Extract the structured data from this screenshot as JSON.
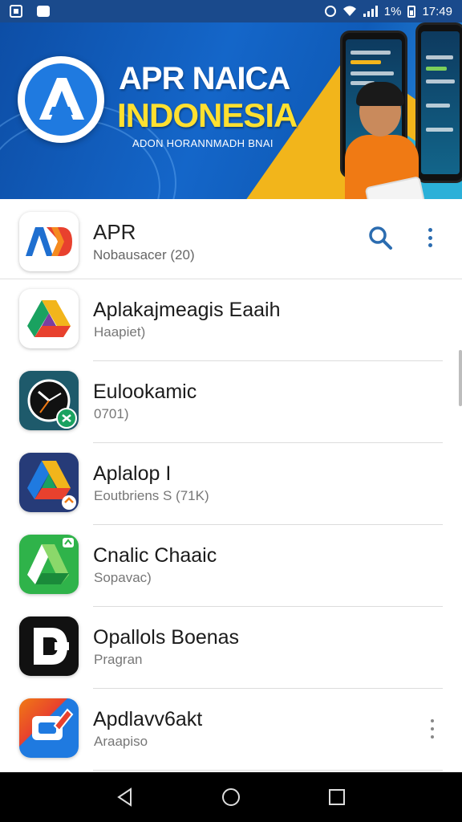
{
  "status_bar": {
    "battery_text": "1%",
    "time": "17:49"
  },
  "banner": {
    "title_line1": "APR NAICA",
    "title_line2": "INDONESIA",
    "subtitle": "ADON HORANNMADH BNAI"
  },
  "header": {
    "app_name": "APR",
    "subtitle": "Nobausacer (20)"
  },
  "apps": [
    {
      "name": "Aplakajmeagis Eaaih",
      "detail": "Haapiet)",
      "icon": "drive-triangle-icon"
    },
    {
      "name": "Eulookamic",
      "detail": "0701)",
      "icon": "clock-icon"
    },
    {
      "name": "Aplalop I",
      "detail": "Eoutbriens S (71K)",
      "icon": "drive-triangle-icon"
    },
    {
      "name": "Cnalic Chaaic",
      "detail": "Sopavac)",
      "icon": "drive-triangle-icon"
    },
    {
      "name": "Opallols Boenas",
      "detail": "Pragran",
      "icon": "letter-d-icon"
    },
    {
      "name": "Apdlavv6akt",
      "detail": "Araapiso",
      "icon": "edit-square-icon"
    }
  ],
  "colors": {
    "status_bar_bg": "#1a4a8c",
    "banner_blue": "#1466c9",
    "banner_yellow": "#ffe030",
    "accent": "#2b6cb0",
    "nav_bar_bg": "#000000"
  }
}
